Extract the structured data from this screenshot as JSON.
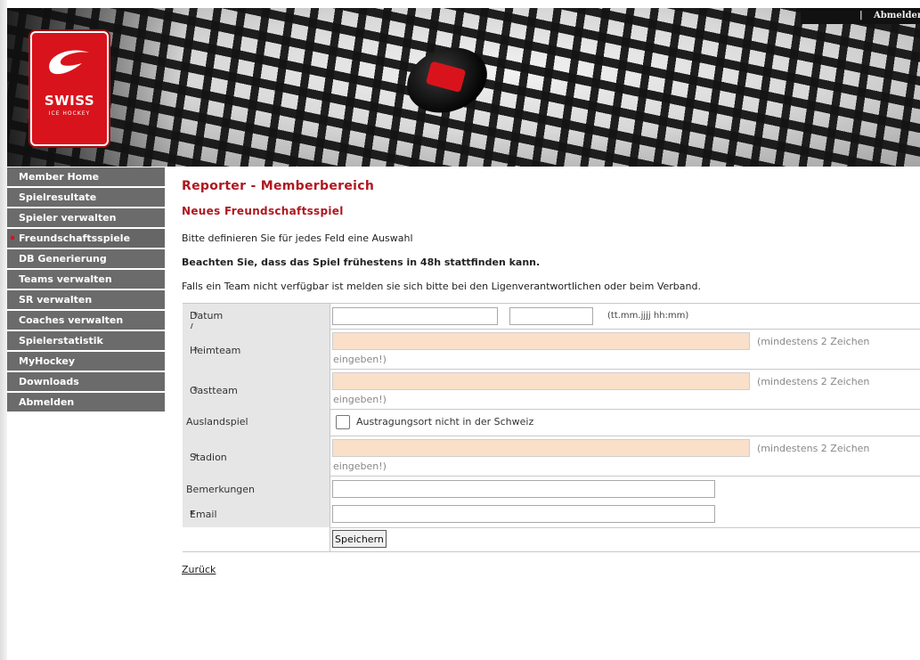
{
  "header": {
    "logo_title": "SWISS",
    "logo_subtitle": "ICE HOCKEY",
    "top_separator": "|",
    "top_link": "Abmelden"
  },
  "sidebar": {
    "items": [
      {
        "label": "Member Home",
        "active": false
      },
      {
        "label": "Spielresultate",
        "active": false
      },
      {
        "label": "Spieler verwalten",
        "active": false
      },
      {
        "label": "Freundschaftsspiele",
        "active": true
      },
      {
        "label": "DB Generierung",
        "active": false
      },
      {
        "label": "Teams verwalten",
        "active": false
      },
      {
        "label": "SR verwalten",
        "active": false
      },
      {
        "label": "Coaches verwalten",
        "active": false
      },
      {
        "label": "Spielerstatistik",
        "active": false
      },
      {
        "label": "MyHockey",
        "active": false
      },
      {
        "label": "Downloads",
        "active": false
      },
      {
        "label": "Abmelden",
        "active": false
      }
    ]
  },
  "main": {
    "title": "Reporter - Memberbereich",
    "subtitle": "Neues Freundschaftsspiel",
    "intro": "Bitte definieren Sie für jedes Feld eine Auswahl",
    "notice": "Beachten Sie, dass das Spiel frühestens in 48h stattfinden kann.",
    "info": "Falls ein Team nicht verfügbar ist melden sie sich bitte bei den Ligenverantwortlichen oder beim Verband."
  },
  "form": {
    "date_label": "Datum / Uhrzeit",
    "date_value": "",
    "time_value": "",
    "date_format_hint": "(tt.mm.jjjj hh:mm)",
    "home_label": "Heimteam",
    "home_value": "",
    "guest_label": "Gastteam",
    "guest_value": "",
    "abroad_label": "Auslandspiel",
    "abroad_checkbox_label": "Austragungsort nicht in der Schweiz",
    "abroad_checked": false,
    "stadium_label": "Stadion",
    "stadium_value": "",
    "hint_part1": "(mindestens 2 Zeichen",
    "hint_part2": "eingeben!)",
    "remarks_label": "Bemerkungen",
    "remarks_value": "",
    "email_label": "Email",
    "email_value": "",
    "required_marker": "*",
    "save_label": "Speichern"
  },
  "footer": {
    "back_link": "Zurück"
  },
  "colors": {
    "accent_red": "#b0171f",
    "sidebar_bg": "#6b6b6b",
    "required_field_bg": "#fadfc9",
    "label_cell_bg": "#e6e6e6"
  }
}
